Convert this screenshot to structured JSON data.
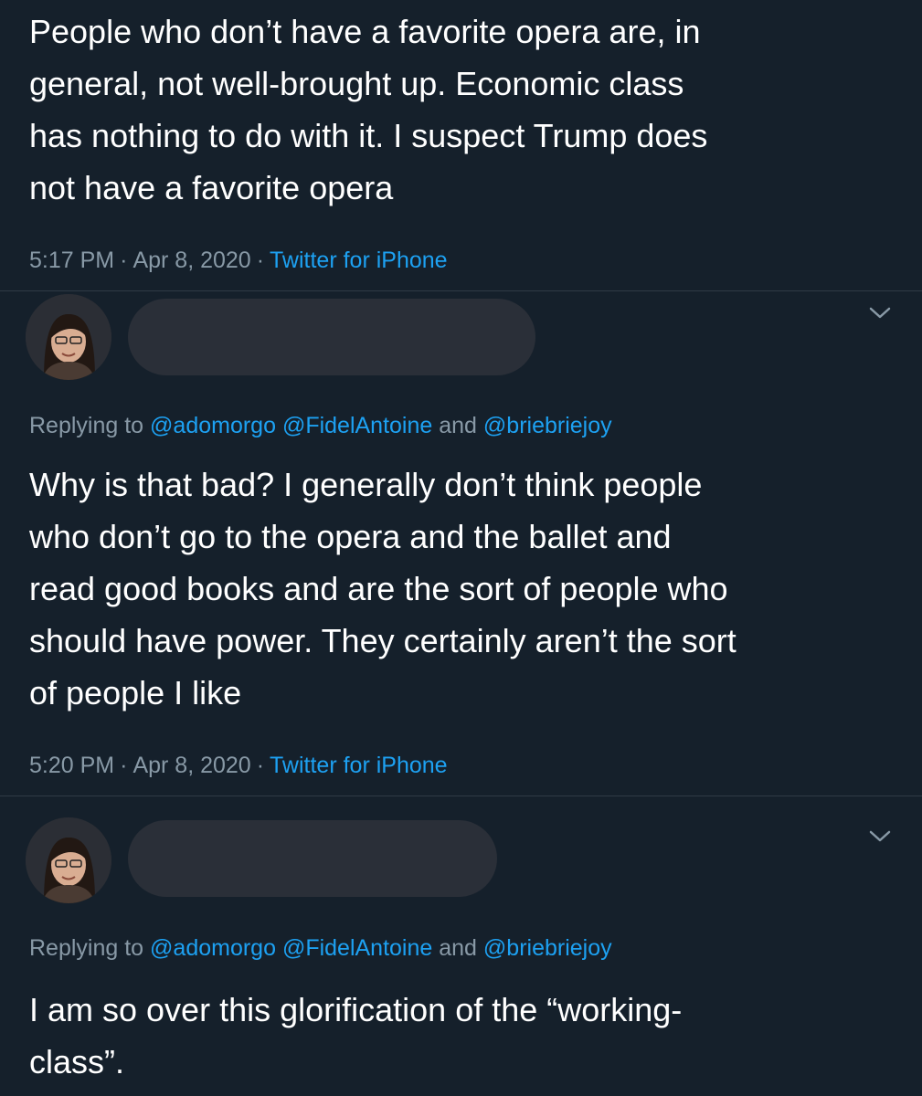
{
  "tweet1": {
    "text": "People who don’t have a favorite opera are, in\ngeneral, not well-brought up. Economic class\nhas nothing to do with it. I suspect Trump does\nnot have a favorite opera",
    "time": "5:17 PM",
    "date": "Apr 8, 2020",
    "source": "Twitter for iPhone"
  },
  "reply1": {
    "replying_prefix": "Replying to",
    "handles": [
      "@adomorgo",
      "@FidelAntoine",
      "@briebriejoy"
    ],
    "and_word": "and",
    "text": "Why is that bad? I generally don’t think people\nwho don’t go to the opera and the ballet and\nread good books and are the sort of people who\nshould have power. They certainly aren’t the sort\nof people I like",
    "time": "5:20 PM",
    "date": "Apr 8, 2020",
    "source": "Twitter for iPhone"
  },
  "reply2": {
    "replying_prefix": "Replying to",
    "handles": [
      "@adomorgo",
      "@FidelAntoine",
      "@briebriejoy"
    ],
    "and_word": "and",
    "text": "I am so over this glorification of the “working-\nclass”."
  },
  "colors": {
    "background": "#15202b",
    "text": "#ffffff",
    "muted": "#8899a6",
    "link": "#1da1f2"
  },
  "icons": {
    "chevron": "chevron-down-icon",
    "avatar": "profile-photo"
  }
}
